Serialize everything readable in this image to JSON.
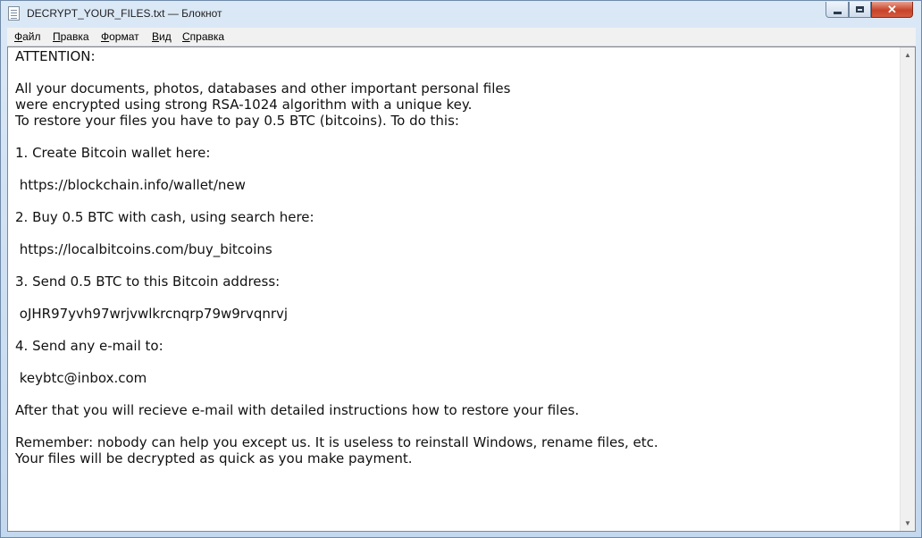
{
  "window": {
    "title": "DECRYPT_YOUR_FILES.txt — Блокнот"
  },
  "menu": [
    "Файл",
    "Правка",
    "Формат",
    "Вид",
    "Справка"
  ],
  "document": {
    "lines": [
      "ATTENTION:",
      "",
      "All your documents, photos, databases and other important personal files",
      "were encrypted using strong RSA-1024 algorithm with a unique key.",
      "To restore your files you have to pay 0.5 BTC (bitcoins). To do this:",
      "",
      "1. Create Bitcoin wallet here:",
      "",
      " https://blockchain.info/wallet/new",
      "",
      "2. Buy 0.5 BTC with cash, using search here:",
      "",
      " https://localbitcoins.com/buy_bitcoins",
      "",
      "3. Send 0.5 BTC to this Bitcoin address:",
      "",
      " oJHR97yvh97wrjvwlkrcnqrp79w9rvqnrvj",
      "",
      "4. Send any e-mail to:",
      "",
      " keybtc@inbox.com",
      "",
      "After that you will recieve e-mail with detailed instructions how to restore your files.",
      "",
      "Remember: nobody can help you except us. It is useless to reinstall Windows, rename files, etc.",
      "Your files will be decrypted as quick as you make payment."
    ]
  },
  "icons": {
    "app": "notepad-icon",
    "minimize": "minimize-icon",
    "maximize": "maximize-icon",
    "close": "close-icon",
    "scroll_up": "scroll-up-icon",
    "scroll_down": "scroll-down-icon"
  }
}
